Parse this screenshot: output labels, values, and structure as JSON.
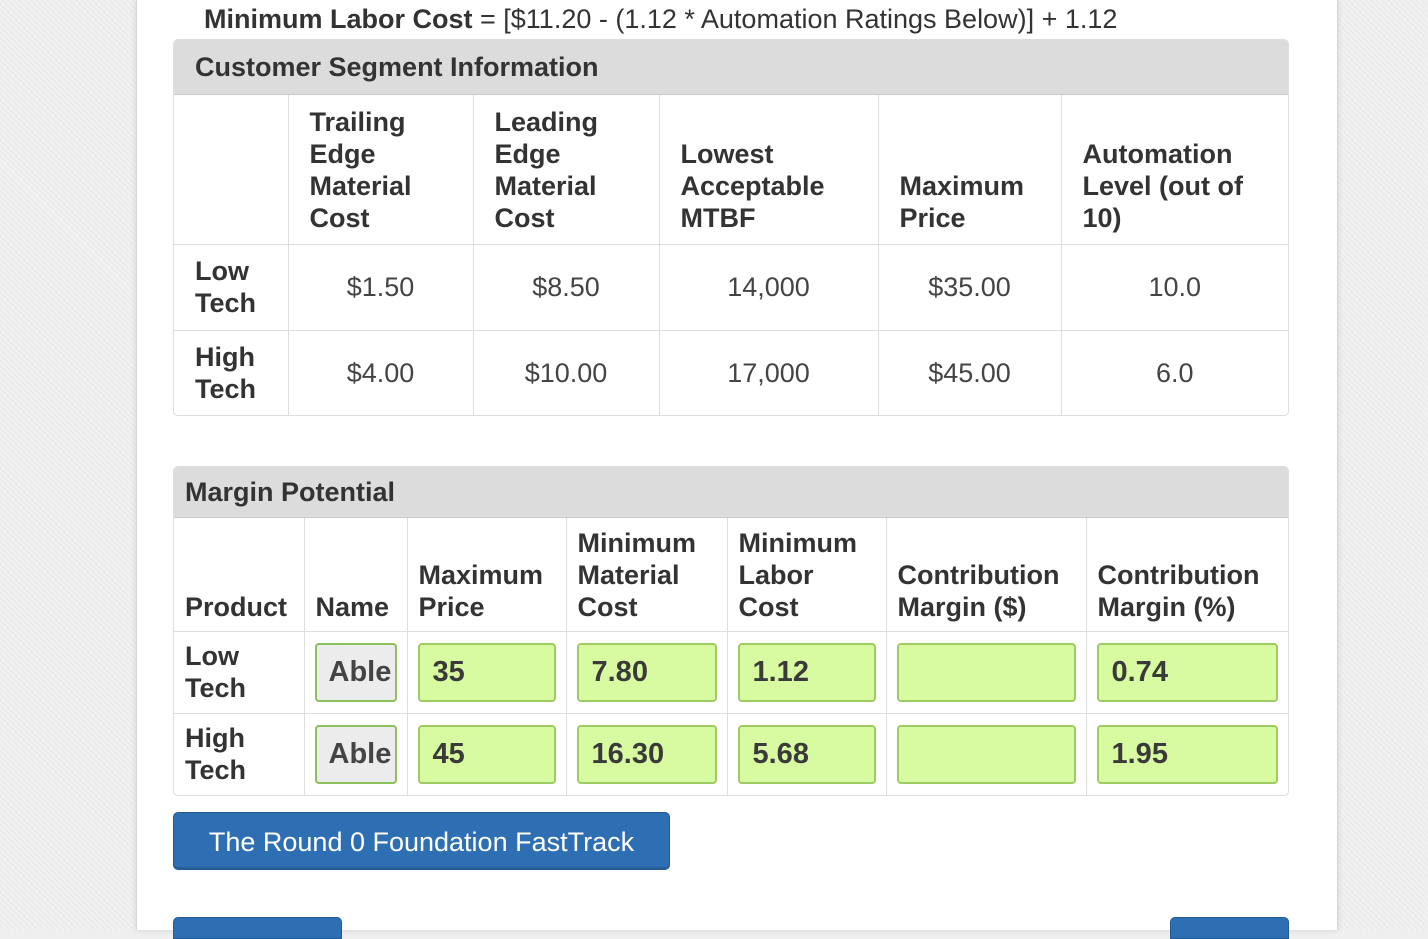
{
  "formula": {
    "label": "Minimum Labor Cost",
    "expression": " = [$11.20 - (1.12 * Automation Ratings Below)] + 1.12"
  },
  "segment_info": {
    "title": "Customer Segment Information",
    "columns": [
      "",
      "Trailing Edge Material Cost",
      "Leading Edge Material Cost",
      "Lowest Acceptable MTBF",
      "Maximum Price",
      "Automation Level (out of 10)"
    ],
    "rows": [
      {
        "segment": "Low Tech",
        "values": [
          "$1.50",
          "$8.50",
          "14,000",
          "$35.00",
          "10.0"
        ]
      },
      {
        "segment": "High Tech",
        "values": [
          "$4.00",
          "$10.00",
          "17,000",
          "$45.00",
          "6.0"
        ]
      }
    ]
  },
  "margin_potential": {
    "title": "Margin Potential",
    "columns": [
      "Product",
      "Name",
      "Maximum Price",
      "Minimum Material Cost",
      "Minimum Labor Cost",
      "Contribution Margin ($)",
      "Contribution Margin (%)"
    ],
    "rows": [
      {
        "product": "Low Tech",
        "name": "Able",
        "max_price": "35",
        "min_material": "7.80",
        "min_labor": "1.12",
        "cm_dollars": "",
        "cm_percent": "0.74"
      },
      {
        "product": "High Tech",
        "name": "Able",
        "max_price": "45",
        "min_material": "16.30",
        "min_labor": "5.68",
        "cm_dollars": "",
        "cm_percent": "1.95"
      }
    ]
  },
  "buttons": {
    "fasttrack": "The Round 0 Foundation FastTrack"
  },
  "colors": {
    "header_bg": "#dcdcdc",
    "input_bg": "#d8fba2",
    "input_border": "#9dcc62",
    "button_bg": "#2e6fb3"
  }
}
